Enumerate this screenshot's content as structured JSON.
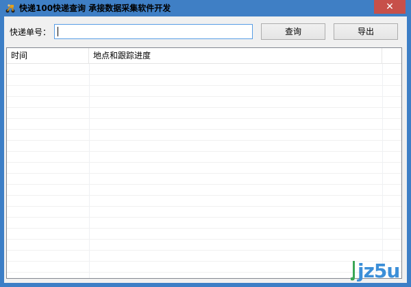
{
  "window": {
    "title": "快递100快递查询  承接数据采集软件开发",
    "close_glyph": "✕"
  },
  "toolbar": {
    "order_label": "快递单号：",
    "order_input_value": "",
    "query_label": "查询",
    "export_label": "导出"
  },
  "table": {
    "columns": [
      "时间",
      "地点和跟踪进度",
      ""
    ],
    "rows": []
  },
  "watermark": {
    "text": "jz5u"
  },
  "icons": {
    "app_icon": "delivery-scooter-icon"
  },
  "colors": {
    "titlebar": "#3f7fc5",
    "close_button": "#c7504a",
    "input_focus_border": "#569de5",
    "watermark": "#3c8fd8"
  }
}
